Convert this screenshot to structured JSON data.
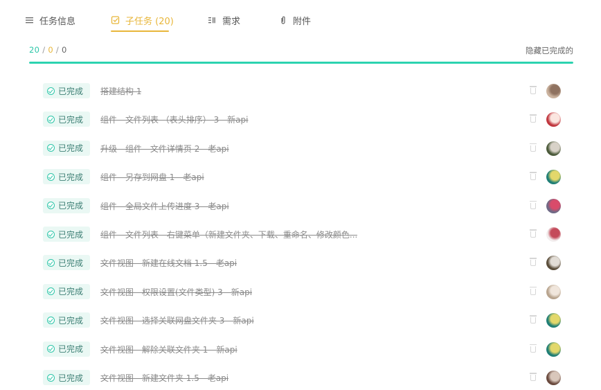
{
  "tabs": [
    {
      "label": "任务信息",
      "icon": "list-icon",
      "active": false
    },
    {
      "label": "子任务 (20)",
      "icon": "subtask-icon",
      "active": true
    },
    {
      "label": "需求",
      "icon": "requirement-icon",
      "active": false
    },
    {
      "label": "附件",
      "icon": "paperclip-icon",
      "active": false
    }
  ],
  "summary": {
    "done": "20",
    "in_progress": "0",
    "todo": "0",
    "hide_completed_label": "隐藏已完成的",
    "progress_fraction": 1.0
  },
  "colors": {
    "accent_yellow": "#e8b63a",
    "done_green": "#2cc6a8",
    "status_bg": "#eaf8f4"
  },
  "subtasks": [
    {
      "status": "已完成",
      "title": "搭建结构 1",
      "avatar": [
        "#cbb39f",
        "#8f7260"
      ]
    },
    {
      "status": "已完成",
      "title": "组件 - 文件列表 （表头排序） 3 - 新api",
      "avatar": [
        "#c0363e",
        "#fbe6e0"
      ]
    },
    {
      "status": "已完成",
      "title": "升级 - 组件 - 文件详情页 2 - 老api",
      "avatar": [
        "#4b5a3a",
        "#d8d2c8"
      ]
    },
    {
      "status": "已完成",
      "title": "组件 - 另存到网盘 1 - 老api",
      "avatar": [
        "#1f7e76",
        "#e3d86b"
      ]
    },
    {
      "status": "已完成",
      "title": "组件 - 全局文件上传进度 3 - 老api",
      "avatar": [
        "#6f6a86",
        "#d94b6a"
      ]
    },
    {
      "status": "已完成",
      "title": "组件 - 文件列表 - 右键菜单（新建文件夹、下载、重命名、修改颜色...",
      "avatar": [
        "#f2eeee",
        "#c44a5a"
      ]
    },
    {
      "status": "已完成",
      "title": "文件视图 - 新建在线文档 1.5 - 老api",
      "avatar": [
        "#5a4d3a",
        "#e2ddd6"
      ]
    },
    {
      "status": "已完成",
      "title": "文件视图 - 权限设置(文件类型) 3 - 新api",
      "avatar": [
        "#b8a48e",
        "#f0e6dc"
      ]
    },
    {
      "status": "已完成",
      "title": "文件视图 - 选择关联网盘文件夹 3 - 新api",
      "avatar": [
        "#1f7e76",
        "#e3d86b"
      ]
    },
    {
      "status": "已完成",
      "title": "文件视图 - 解除关联文件夹 1 - 新api",
      "avatar": [
        "#1f7e76",
        "#e3d86b"
      ]
    },
    {
      "status": "已完成",
      "title": "文件视图 - 新建文件夹 1.5 - 老api",
      "avatar": [
        "#6a4a3e",
        "#d9c7bb"
      ]
    }
  ]
}
